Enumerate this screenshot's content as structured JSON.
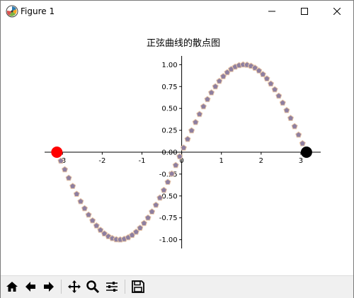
{
  "window": {
    "title": "Figure 1"
  },
  "toolbar": {
    "buttons": [
      "home-icon",
      "back-arrow-icon",
      "forward-arrow-icon",
      "pan-icon",
      "zoom-icon",
      "configure-subplots-icon",
      "save-icon"
    ]
  },
  "colors": {
    "marker_fill": "#8e7fa0",
    "marker_edge": "#e8c6a8",
    "start_point": "#ff0000",
    "end_point": "#000000",
    "axis": "#000000"
  },
  "chart_data": {
    "type": "scatter",
    "title": "正弦曲线的散点图",
    "xlabel": "",
    "ylabel": "",
    "xlim": [
      -3.45,
      3.5
    ],
    "ylim": [
      -1.1,
      1.1
    ],
    "xticks": [
      "-3",
      "-2",
      "-1",
      "0",
      "1",
      "2",
      "3"
    ],
    "yticks": [
      "-1.00",
      "-0.75",
      "-0.50",
      "-0.25",
      "0.00",
      "0.25",
      "0.50",
      "0.75",
      "1.00"
    ],
    "spines": "centered at origin",
    "grid": false,
    "series": [
      {
        "function": "y = sin(x)",
        "x_start": -3.14159,
        "x_end": 3.14159,
        "num_points": 64,
        "marker": "pentagon"
      }
    ],
    "highlight_points": [
      {
        "x": -3.14159,
        "y": 0,
        "color": "red"
      },
      {
        "x": 3.14159,
        "y": 0,
        "color": "black"
      }
    ]
  }
}
